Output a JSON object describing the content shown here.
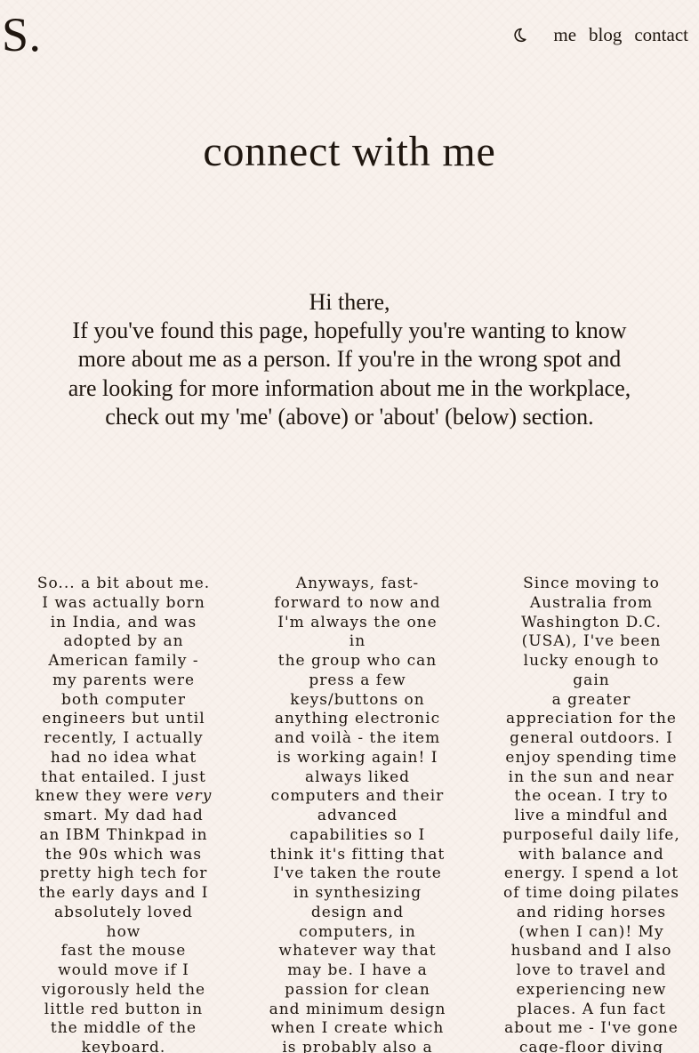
{
  "header": {
    "logo": "S.",
    "theme_toggle_icon": "crescent-moon-icon",
    "nav_items": [
      {
        "label": "me"
      },
      {
        "label": "blog"
      },
      {
        "label": "contact"
      }
    ]
  },
  "hero": {
    "title": "connect with me"
  },
  "intro": {
    "lines": [
      "Hi there,",
      "If you've found this page, hopefully you're wanting to know",
      "more about me as a person. If you're in the wrong spot and",
      "are looking for more information about me in the workplace,",
      "check out my 'me' (above) or 'about' (below) section."
    ]
  },
  "columns": [
    {
      "before_em": "So... a bit about me.\nI was actually born\nin India, and was\nadopted by an\nAmerican family -\nmy parents were\nboth computer\nengineers but until\nrecently, I actually\nhad no idea what\nthat entailed. I just\nknew they were ",
      "em": "very",
      "after_em": "\nsmart. My dad had\nan IBM Thinkpad in\nthe 90s which was\npretty high tech for\nthe early days and I\nabsolutely loved how\nfast the mouse\nwould move if I\nvigorously held the\nlittle red button in\nthe middle of the\nkeyboard."
    },
    {
      "text": "Anyways, fast-\nforward to now and\nI'm always the one in\nthe group who can\npress a few\nkeys/buttons on\nanything electronic\nand voilà - the item\nis working again! I\nalways liked\ncomputers and their\nadvanced\ncapabilities so I\nthink it's fitting that\nI've taken the route\nin synthesizing\ndesign and\ncomputers, in\nwhatever way that\nmay be. I have a\npassion for clean\nand minimum design\nwhen I create which\nis probably also a\ntestament to my"
    },
    {
      "text": "Since moving to\nAustralia from\nWashington D.C.\n(USA), I've been\nlucky enough to gain\na greater\nappreciation for the\ngeneral outdoors. I\nenjoy spending time\nin the sun and near\nthe ocean. I try to\nlive a mindful and\npurposeful daily life,\nwith balance and\nenergy. I spend a lot\nof time doing pilates\nand riding horses\n(when I can)! My\nhusband and I also\nlove to travel and\nexperiencing new\nplaces. A fun fact\nabout me - I've gone\ncage-floor diving\nwith great white"
    }
  ]
}
